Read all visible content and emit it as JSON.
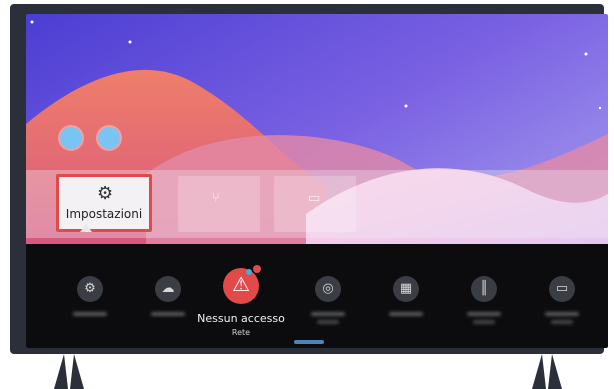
{
  "tv": {
    "quick_tiles": [
      {
        "icon": "gear-icon",
        "label": "Impostazioni",
        "focused": true
      },
      {
        "icon": "share-icon",
        "label": ""
      },
      {
        "icon": "tv-icon",
        "label": ""
      }
    ],
    "profiles": [
      "profile-avatar",
      "profile-avatar"
    ],
    "settings_menu": [
      {
        "icon": "gear-icon",
        "label": ""
      },
      {
        "icon": "cloud-icon",
        "label": ""
      },
      {
        "icon": "warning-icon",
        "label": "Nessun accesso",
        "sublabel": "Rete",
        "selected": true
      },
      {
        "icon": "target-icon",
        "label": ""
      },
      {
        "icon": "picture-icon",
        "label": ""
      },
      {
        "icon": "sound-icon",
        "label": ""
      },
      {
        "icon": "monitor-icon",
        "label": ""
      }
    ]
  },
  "colors": {
    "accent_red": "#e24a4a",
    "bar": "#0c0c0e",
    "frame": "#2a2f3a"
  }
}
